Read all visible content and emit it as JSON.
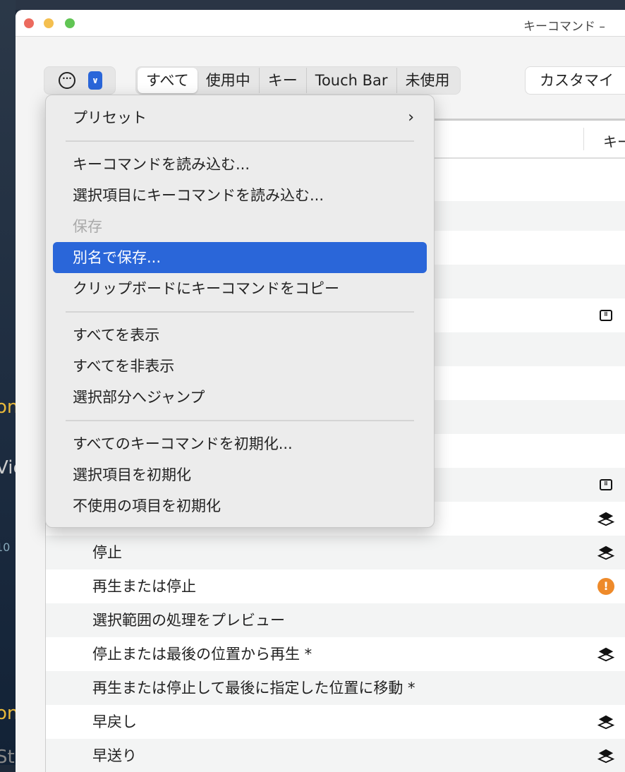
{
  "window": {
    "title": "キーコマンド –"
  },
  "toolbar": {
    "filters": [
      "すべて",
      "使用中",
      "キー",
      "Touch Bar",
      "未使用"
    ],
    "selected_filter": "すべて",
    "customize_label": "カスタマイ"
  },
  "table": {
    "key_column_header": "キー",
    "rows": [
      {
        "label": "",
        "icon": ""
      },
      {
        "label": "",
        "icon": ""
      },
      {
        "label": "",
        "icon": ""
      },
      {
        "label": "",
        "icon": ""
      },
      {
        "label": "",
        "icon": "keypad-icon"
      },
      {
        "label": "",
        "icon": ""
      },
      {
        "label": "",
        "icon": ""
      },
      {
        "label": "",
        "icon": ""
      },
      {
        "label": "",
        "icon": ""
      },
      {
        "label": "",
        "icon": "keypad-icon"
      },
      {
        "label": "",
        "icon": "layers-icon"
      },
      {
        "label": "停止",
        "icon": "layers-icon"
      },
      {
        "label": "再生または停止",
        "icon": "warning-icon"
      },
      {
        "label": "選択範囲の処理をプレビュー",
        "icon": ""
      },
      {
        "label": "停止または最後の位置から再生 *",
        "icon": "layers-icon"
      },
      {
        "label": "再生または停止して最後に指定した位置に移動 *",
        "icon": ""
      },
      {
        "label": "早戻し",
        "icon": "layers-icon"
      },
      {
        "label": "早送り",
        "icon": "layers-icon"
      }
    ]
  },
  "menu": {
    "items": [
      {
        "label": "プリセット",
        "submenu": true
      },
      {
        "sep": true
      },
      {
        "label": "キーコマンドを読み込む..."
      },
      {
        "label": "選択項目にキーコマンドを読み込む..."
      },
      {
        "label": "保存",
        "disabled": true
      },
      {
        "label": "別名で保存...",
        "highlighted": true
      },
      {
        "label": "クリップボードにキーコマンドをコピー"
      },
      {
        "sep": true
      },
      {
        "label": "すべてを表示"
      },
      {
        "label": "すべてを非表示"
      },
      {
        "label": "選択部分へジャンプ"
      },
      {
        "sep": true
      },
      {
        "label": "すべてのキーコマンドを初期化..."
      },
      {
        "label": "選択項目を初期化"
      },
      {
        "label": "不使用の項目を初期化"
      }
    ]
  },
  "background": {
    "texts": [
      "on",
      "Vie",
      "10",
      "on",
      "St"
    ]
  },
  "colors": {
    "accent": "#2a66d9",
    "warning": "#ee8a2a"
  }
}
